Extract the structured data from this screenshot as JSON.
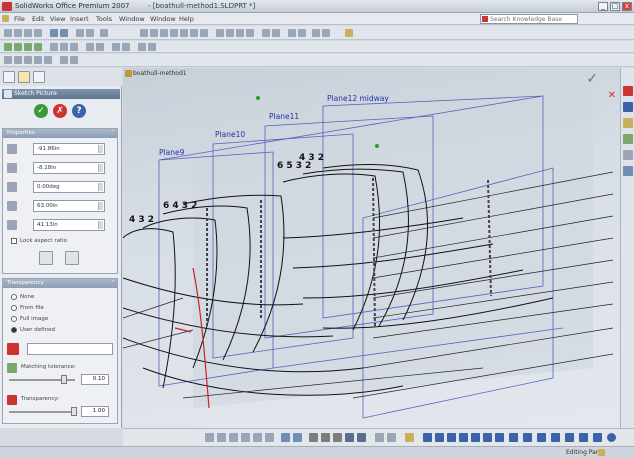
{
  "window": {
    "app_title": "SolidWorks Office Premium 2007",
    "doc_title": "- [boathull-method1.SLDPRT *]",
    "minimize": "_",
    "maximize": "□",
    "close": "x"
  },
  "menu": {
    "items": [
      "File",
      "Edit",
      "View",
      "Insert",
      "Tools",
      "Window",
      "Window",
      "Help"
    ],
    "search_placeholder": "Search Knowledge Base"
  },
  "property_manager": {
    "header": "Sketch Picture",
    "ok_symbol": "✓",
    "cancel_symbol": "✗",
    "help_symbol": "?",
    "properties_group": "Properties",
    "fields": [
      {
        "icon": "x-position-icon",
        "value": "-91.86in"
      },
      {
        "icon": "y-position-icon",
        "value": "-8.18in"
      },
      {
        "icon": "angle-icon",
        "value": "0.00deg"
      },
      {
        "icon": "width-icon",
        "value": "63.00in"
      },
      {
        "icon": "height-icon",
        "value": "41.13in"
      }
    ],
    "lock_aspect_label": "Lock aspect ratio",
    "transparency_group": "Transparency",
    "transparency_options": [
      "None",
      "From file",
      "Full image",
      "User defined"
    ],
    "matching_tolerance_label": "Matching tolerance:",
    "matching_tolerance_value": "0.10",
    "transparency_label": "Transparency:",
    "transparency_value": "1.00"
  },
  "graphics": {
    "tree_root": "boathull-method1",
    "planes": [
      "Plane9",
      "Plane10",
      "Plane11",
      "Plane12 midway"
    ]
  },
  "statusbar": {
    "right_text": "Editing Part"
  },
  "colors": {
    "plane_label": "#2432a8",
    "header_bg": "#5f7490",
    "ok_green": "#3a9a3a",
    "cancel_red": "#cc3333"
  }
}
